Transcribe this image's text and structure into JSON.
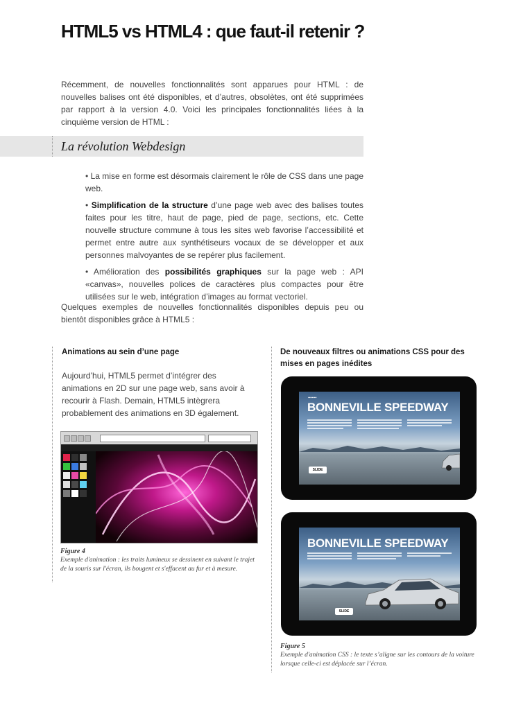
{
  "title": "HTML5 vs HTML4 : que faut-il retenir ?",
  "intro": "Récemment, de nouvelles fonctionnalités sont apparues pour HTML : de nouvelles balises ont été disponibles, et d’autres, obsolètes, ont été supprimées par rapport à la version 4.0. Voici les principales fonctionnalités liées à la cinquième version de HTML :",
  "section": {
    "title": "La révolution Webdesign"
  },
  "bullets": [
    {
      "prefix": "• La mise en forme est désormais clairement le rôle de CSS dans une page web.",
      "bold": "",
      "rest": ""
    },
    {
      "prefix": "• ",
      "bold": "Simplification de la structure",
      "rest": " d’une page web avec des balises toutes faites pour les titre, haut de page, pied de page, sections, etc. Cette nouvelle structure commune à tous les sites web favorise l’accessibilité et permet entre autre aux synthétiseurs vocaux de se développer et aux personnes malvoyantes de se repérer plus facilement."
    },
    {
      "prefix": "• Amélioration des ",
      "bold": "possibilités graphiques",
      "rest": " sur la page web : API «canvas», nouvelles polices de caractères plus compactes pour être utilisées sur le web, intégration d’images au format vectoriel."
    }
  ],
  "outro": "Quelques exemples de nouvelles fonctionnalités disponibles depuis peu ou bientôt disponibles grâce à HTML5 :",
  "left_column": {
    "title": "Animations au sein d’une page",
    "text": "Aujourd’hui, HTML5 permet d’intégrer des animations en 2D sur une page web, sans avoir à recourir à Flash. Demain, HTML5 intègrera probablement des animations en 3D également.",
    "figure_label": "Figure 4",
    "figure_caption": "Exemple d'animation : les traits lumineux se dessinent en suivant le trajet de la souris sur l'écran, ils bougent et s'effacent au fur et à mesure."
  },
  "right_column": {
    "title": "De nouveaux filtres ou animations CSS pour des mises en pages inédites",
    "figure_label": "Figure 5",
    "figure_caption": "Exemple d'animation CSS : le texte s’aligne sur les contours de la voiture lorsque celle-ci est déplacée sur l’écran.",
    "tablet_headline": "BONNEVILLE SPEEDWAY",
    "slide_label": "SLIDE"
  },
  "colors": {
    "section_bar": "#e6e6e6",
    "title": "#111111",
    "body_text": "#404040"
  }
}
